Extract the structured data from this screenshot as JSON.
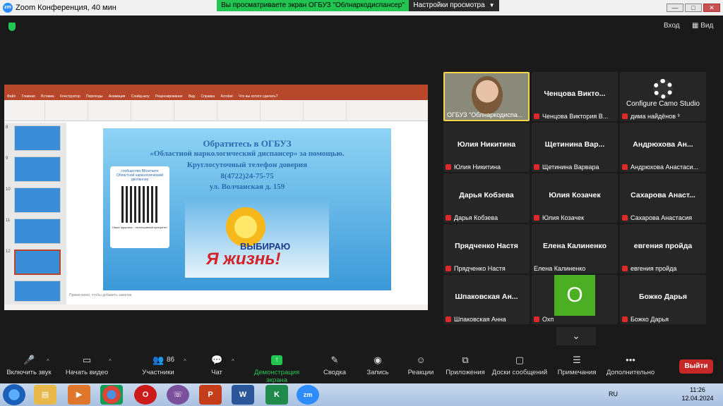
{
  "window": {
    "title": "Zoom Конференция, 40 мин",
    "app_icon": "zm",
    "minimize": "—",
    "maximize": "□",
    "close": "✕"
  },
  "share_banner": {
    "text": "Вы просматриваете экран ОГБУЗ \"Облнаркодиспансер\"",
    "view_options": "Настройки просмотра"
  },
  "top_controls": {
    "enter": "Вход",
    "view": "Вид"
  },
  "slide": {
    "line1": "Обратитесь в ОГБУЗ",
    "line2": "«Областной наркологический диспансер» за помощью.",
    "line3": "Круглосуточный телефон доверия",
    "line4": "8(4722)24-75-75",
    "line5": "ул. Волчанская д. 159",
    "qr_caption": "сообщество ВКонтакте Областной наркологический диспансер",
    "qr_footer": "Наше здоровье - неоспоримый приоритет",
    "poster_top": "ВЫБИРАЮ",
    "poster_main": "Я жизнь!",
    "notes_placeholder": "Примечания, чтобы добавить заметки"
  },
  "ppt": {
    "tabs": [
      "Файл",
      "Главная",
      "Вставка",
      "Конструктор",
      "Переходы",
      "Анимация",
      "Слайд-шоу",
      "Рецензирование",
      "Вид",
      "Справка",
      "Acrobat",
      "Что вы хотите сделать?"
    ],
    "thumb_numbers": [
      "8",
      "9",
      "10",
      "11",
      "12"
    ]
  },
  "participants": [
    {
      "name": "",
      "label": "ОГБУЗ \"Облнаркодиспа...",
      "type": "video",
      "active": true,
      "muted": false
    },
    {
      "name": "Ченцова Викто...",
      "label": "Ченцова Виктория В...",
      "type": "name",
      "muted": true
    },
    {
      "name": "Configure Camo Studio",
      "label": "дима найдёнов ³",
      "type": "camo",
      "muted": true
    },
    {
      "name": "Юлия Никитина",
      "label": "Юлия Никитина",
      "type": "name",
      "muted": true
    },
    {
      "name": "Щетинина Вар...",
      "label": "Щетинина Варвара",
      "type": "name",
      "muted": true
    },
    {
      "name": "Андрюхова Ан...",
      "label": "Андрюхова Анастаси...",
      "type": "name",
      "muted": true
    },
    {
      "name": "Дарья Кобзева",
      "label": "Дарья Кобзева",
      "type": "name",
      "muted": true
    },
    {
      "name": "Юлия Козачек",
      "label": "Юлия Козачек",
      "type": "name",
      "muted": true
    },
    {
      "name": "Сахарова Анаст...",
      "label": "Сахарова Анастасия",
      "type": "name",
      "muted": true
    },
    {
      "name": "Прядченко Настя",
      "label": "Прядченко Настя",
      "type": "name",
      "muted": true
    },
    {
      "name": "Елена Калиненко",
      "label": "Елена Калиненко",
      "type": "name",
      "muted": false
    },
    {
      "name": "евгения пройда",
      "label": "евгения пройда",
      "type": "name",
      "muted": true
    },
    {
      "name": "Шпаковская Ан...",
      "label": "Шпаковская Анна",
      "type": "name",
      "muted": true
    },
    {
      "name": "O",
      "label": "Охп",
      "type": "avatar",
      "muted": true
    },
    {
      "name": "Божко Дарья",
      "label": "Божко Дарья",
      "type": "name",
      "muted": true
    }
  ],
  "gallery_more": "⌄",
  "toolbar": {
    "mute": "Включить звук",
    "video": "Начать видео",
    "participants": "Участники",
    "participants_count": "86",
    "chat": "Чат",
    "share": "Демонстрация экрана",
    "summary": "Сводка",
    "record": "Запись",
    "reactions": "Реакции",
    "apps": "Приложения",
    "whiteboards": "Доски сообщений",
    "notes": "Примечания",
    "more": "Дополнительно",
    "leave": "Выйти"
  },
  "taskbar": {
    "apps": [
      "explorer",
      "media",
      "chrome",
      "opera",
      "viber",
      "powerpoint",
      "word",
      "kaspersky",
      "zoom"
    ],
    "lang": "RU",
    "time": "11:26",
    "date": "12.04.2024"
  }
}
